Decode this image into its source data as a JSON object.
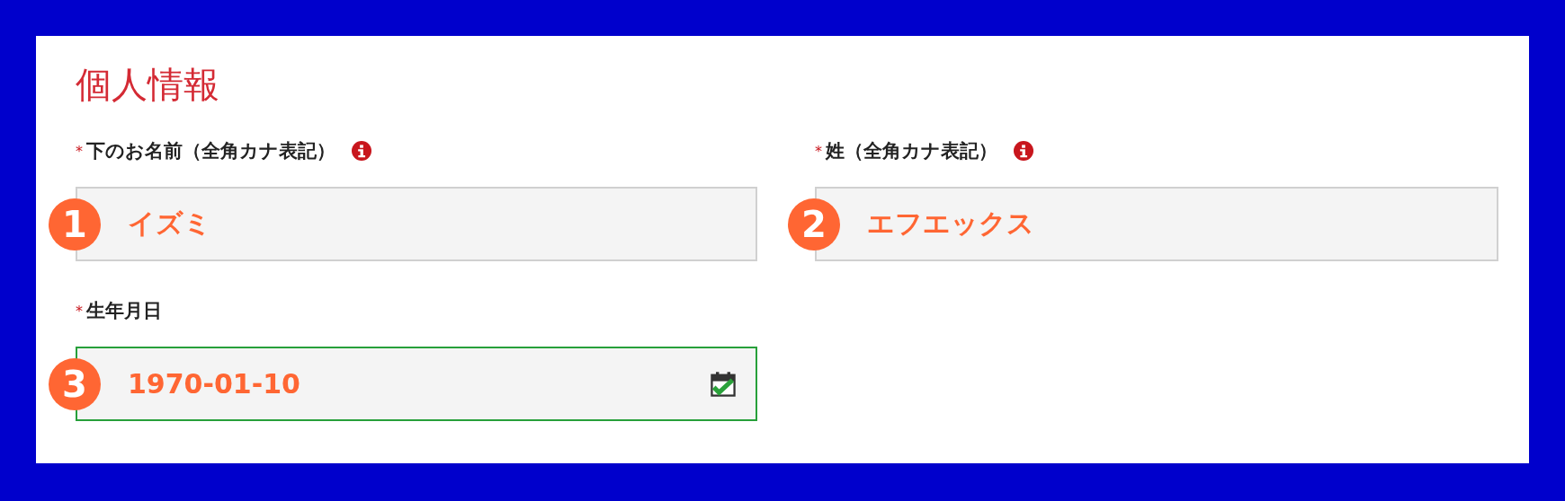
{
  "title": "個人情報",
  "fields": [
    {
      "kind": "text",
      "required_mark": "*",
      "label": "下のお名前（全角カナ表記）",
      "info": true,
      "badge": "1",
      "value": "イズミ",
      "valid": false
    },
    {
      "kind": "text",
      "required_mark": "*",
      "label": "姓（全角カナ表記）",
      "info": true,
      "badge": "2",
      "value": "エフエックス",
      "valid": false
    },
    {
      "kind": "date",
      "required_mark": "*",
      "label": "生年月日",
      "info": false,
      "badge": "3",
      "value": "1970-01-10",
      "valid": true
    }
  ]
}
